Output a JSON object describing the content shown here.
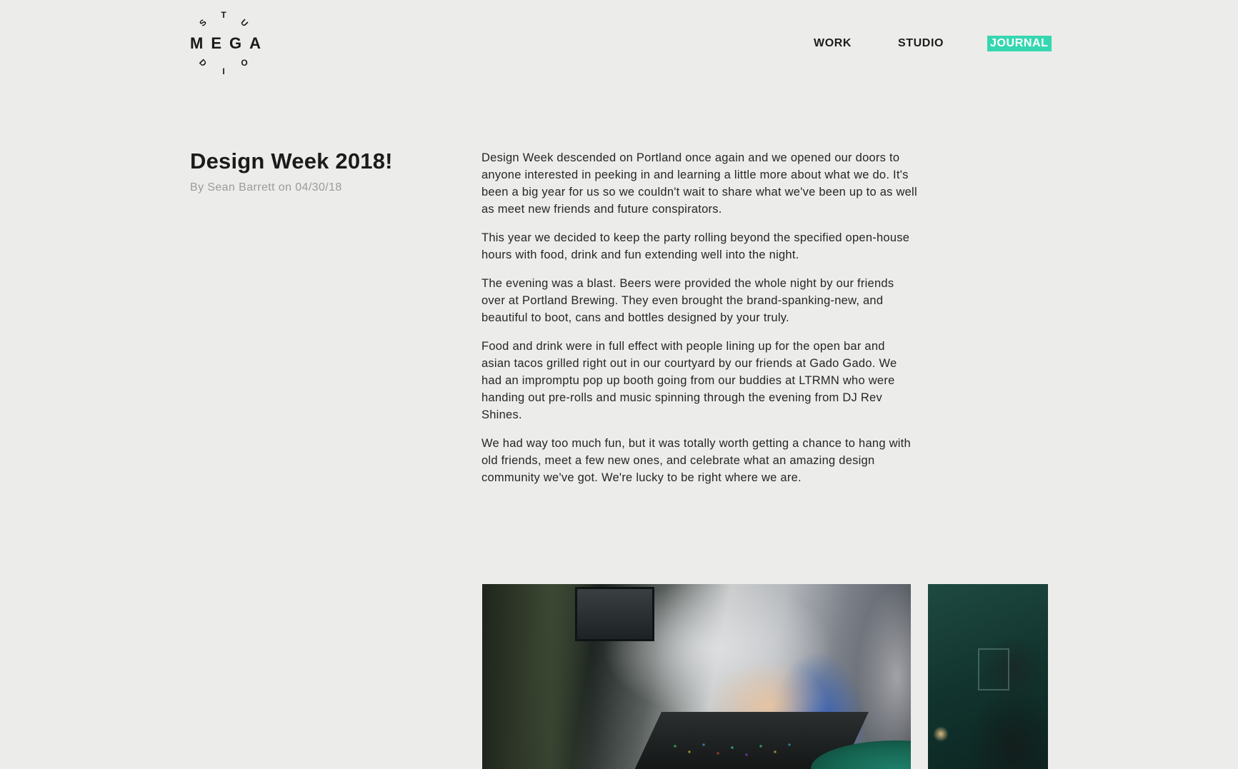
{
  "brand": {
    "logo_ring_top": "T",
    "logo_ring_left_top": "S",
    "logo_ring_right_top": "U",
    "logo_ring_left_bottom": "D",
    "logo_ring_right_bottom": "O",
    "logo_ring_bottom": "I",
    "logo_word": "MEGA"
  },
  "nav": {
    "items": [
      {
        "label": "WORK",
        "active": false
      },
      {
        "label": "STUDIO",
        "active": false
      },
      {
        "label": "JOURNAL",
        "active": true
      }
    ]
  },
  "colors": {
    "background": "#ececea",
    "accent": "#36d7b0",
    "text": "#1e1e1e",
    "muted": "#9a9a98"
  },
  "article": {
    "title": "Design Week 2018!",
    "byline": "By Sean Barrett on 04/30/18",
    "paragraphs": [
      "Design Week descended on Portland once again and we opened our doors to anyone interested in peeking in and learning a little more about what we do. It's been a big year for us so we couldn't wait to share what we've been up to as well as meet new friends and future conspirators.",
      "This year we decided to keep the party rolling beyond the specified open-house hours with food, drink and fun extending well into the night.",
      "The evening was a blast. Beers were provided the whole night by our friends over at Portland Brewing. They even brought the brand-spanking-new, and beautiful to boot, cans and bottles designed by your truly.",
      "Food and drink were in full effect with people lining up for the open bar and asian tacos grilled right out in our courtyard by our friends at Gado Gado. We had an impromptu pop up booth going from our buddies at LTRMN who were handing out pre-rolls and music spinning through the evening from DJ Rev Shines.",
      "We had way too much fun, but it was totally worth getting a chance to hang with old friends, meet a few new ones, and celebrate what an amazing design community we've got. We're lucky to be right where we are."
    ]
  }
}
